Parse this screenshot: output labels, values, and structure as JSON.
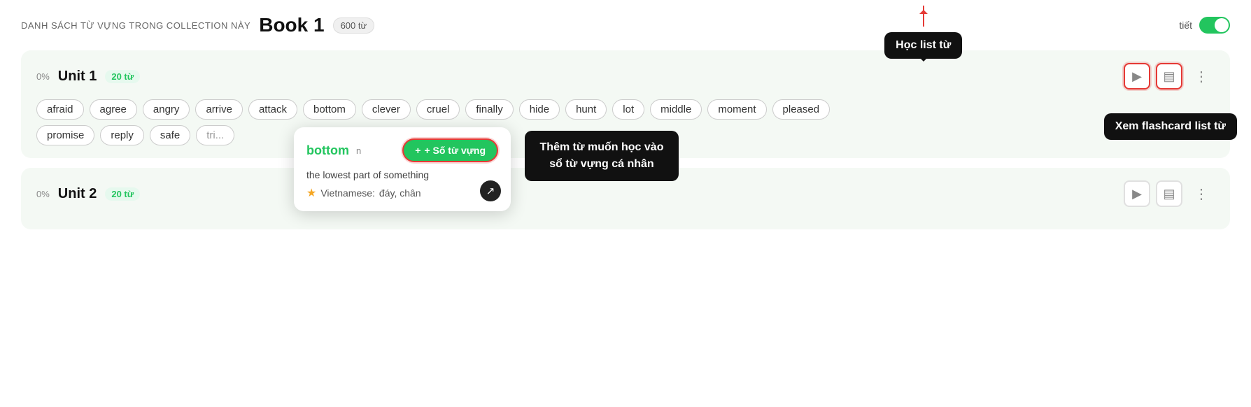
{
  "header": {
    "collection_label": "DANH SÁCH TỪ VỰNG TRONG COLLECTION NÀY",
    "book_title": "Book 1",
    "word_count": "600 từ",
    "detail_label": "tiết"
  },
  "unit1": {
    "progress": "0%",
    "title": "Unit 1",
    "word_count": "20 từ",
    "words": [
      "afraid",
      "agree",
      "angry",
      "arrive",
      "attack",
      "bottom",
      "clever",
      "cruel",
      "finally",
      "hide",
      "hunt",
      "lot",
      "middle",
      "moment",
      "pleased"
    ],
    "words_row2": [
      "promise",
      "reply",
      "safe",
      "tri..."
    ],
    "tooltip": {
      "word": "bottom",
      "pos": "n",
      "add_btn_label": "+ Số từ vựng",
      "definition": "the lowest part of something",
      "vietnamese_label": "Vietnamese:",
      "vietnamese_value": "đáy, chân"
    }
  },
  "unit2": {
    "progress": "0%",
    "title": "Unit 2",
    "word_count": "20 từ"
  },
  "annotations": {
    "hoc_list": "Học list từ",
    "xem_flashcard": "Xem flashcard list từ",
    "them_tu": "Thêm từ muốn học vào\nsổ từ vựng cá nhân"
  },
  "icons": {
    "play": "▶",
    "flashcard": "▤",
    "share": "⋮",
    "star": "★",
    "arrow": "↗"
  }
}
